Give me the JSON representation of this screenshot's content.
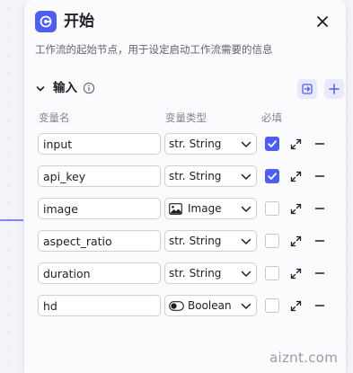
{
  "panel": {
    "title": "开始",
    "description": "工作流的起始节点，用于设定启动工作流需要的信息",
    "accent_color": "#4e5ef0",
    "icons": {
      "node": "start-node-icon",
      "close": "close-icon"
    }
  },
  "section": {
    "title": "输入",
    "icons": {
      "collapse": "chevron-down-icon",
      "info": "info-icon",
      "import": "import-icon",
      "add": "plus-icon"
    }
  },
  "columns": {
    "name": "变量名",
    "type": "变量类型",
    "required": "必填"
  },
  "variables": [
    {
      "name": "input",
      "type": "String",
      "type_icon": "str.",
      "required": true
    },
    {
      "name": "api_key",
      "type": "String",
      "type_icon": "str.",
      "required": true
    },
    {
      "name": "image",
      "type": "Image",
      "type_icon": "image-icon",
      "required": false
    },
    {
      "name": "aspect_ratio",
      "type": "String",
      "type_icon": "str.",
      "required": false
    },
    {
      "name": "duration",
      "type": "String",
      "type_icon": "str.",
      "required": false
    },
    {
      "name": "hd",
      "type": "Boolean",
      "type_icon": "toggle-icon",
      "required": false
    }
  ],
  "watermark": "aiznt.com"
}
